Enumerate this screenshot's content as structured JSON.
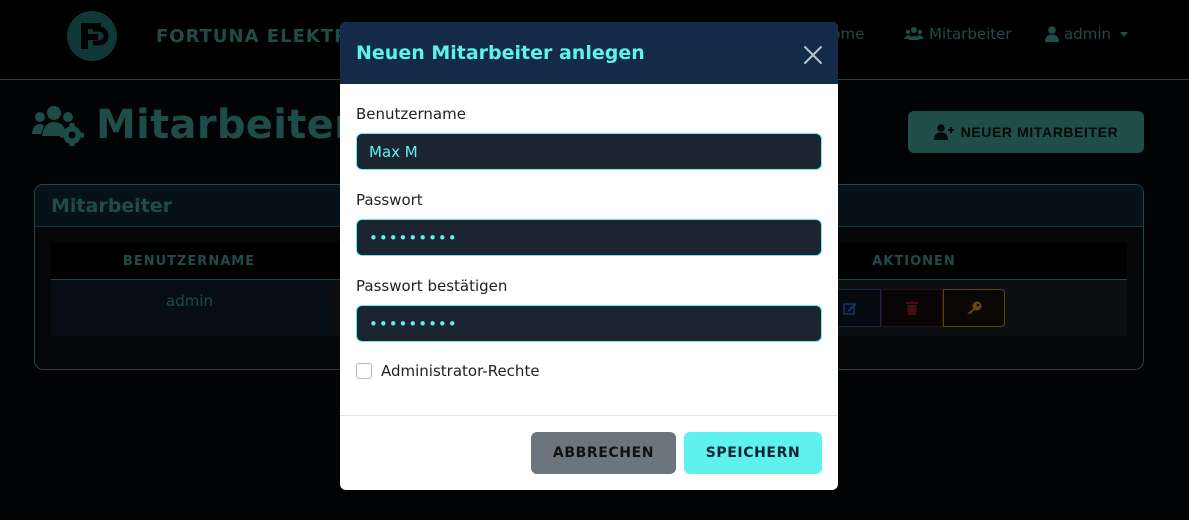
{
  "navbar": {
    "brand": "FORTUNA ELEKTRO",
    "items": [
      {
        "label": "Home"
      },
      {
        "label": "Mitarbeiter",
        "icon": "users-icon"
      },
      {
        "label": "admin",
        "icon": "user-icon"
      }
    ]
  },
  "page": {
    "title": "Mitarbeiterverwaltung",
    "new_button_label": "NEUER MITARBEITER"
  },
  "card": {
    "title": "Mitarbeiter",
    "columns": [
      "BENUTZERNAME",
      "AKTIONEN"
    ],
    "rows": [
      {
        "username": "admin"
      }
    ]
  },
  "modal": {
    "title": "Neuen Mitarbeiter anlegen",
    "fields": {
      "username": {
        "label": "Benutzername",
        "value": "Max M"
      },
      "password": {
        "label": "Passwort",
        "value": "•••••••••"
      },
      "password_confirm": {
        "label": "Passwort bestätigen",
        "value": "•••••••••"
      }
    },
    "admin_checkbox_label": "Administrator-Rechte",
    "cancel_label": "ABBRECHEN",
    "save_label": "SPEICHERN"
  },
  "colors": {
    "accent": "#3d9890",
    "highlight": "#5ef2ee",
    "modal_header": "#132b48",
    "edit": "#1e6bd6",
    "delete": "#8a1c2a",
    "key": "#c9951a"
  }
}
